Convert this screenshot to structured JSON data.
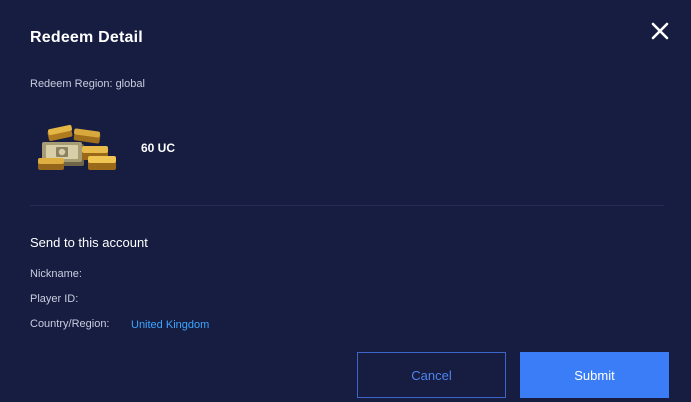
{
  "dialog": {
    "title": "Redeem Detail",
    "close_icon": "close-icon"
  },
  "region": {
    "label": "Redeem Region:",
    "value": "global"
  },
  "product": {
    "icon": "gold-bars-cash-icon",
    "name": "60 UC"
  },
  "account": {
    "section_title": "Send to this account",
    "nickname_label": "Nickname:",
    "player_id_label": "Player ID:",
    "country_label": "Country/Region:",
    "country_value": "United Kingdom"
  },
  "buttons": {
    "cancel_label": "Cancel",
    "submit_label": "Submit"
  },
  "colors": {
    "background": "#161d40",
    "accent": "#3a7df6",
    "link": "#3ea5ff",
    "cancel_border": "#3d65c9"
  }
}
